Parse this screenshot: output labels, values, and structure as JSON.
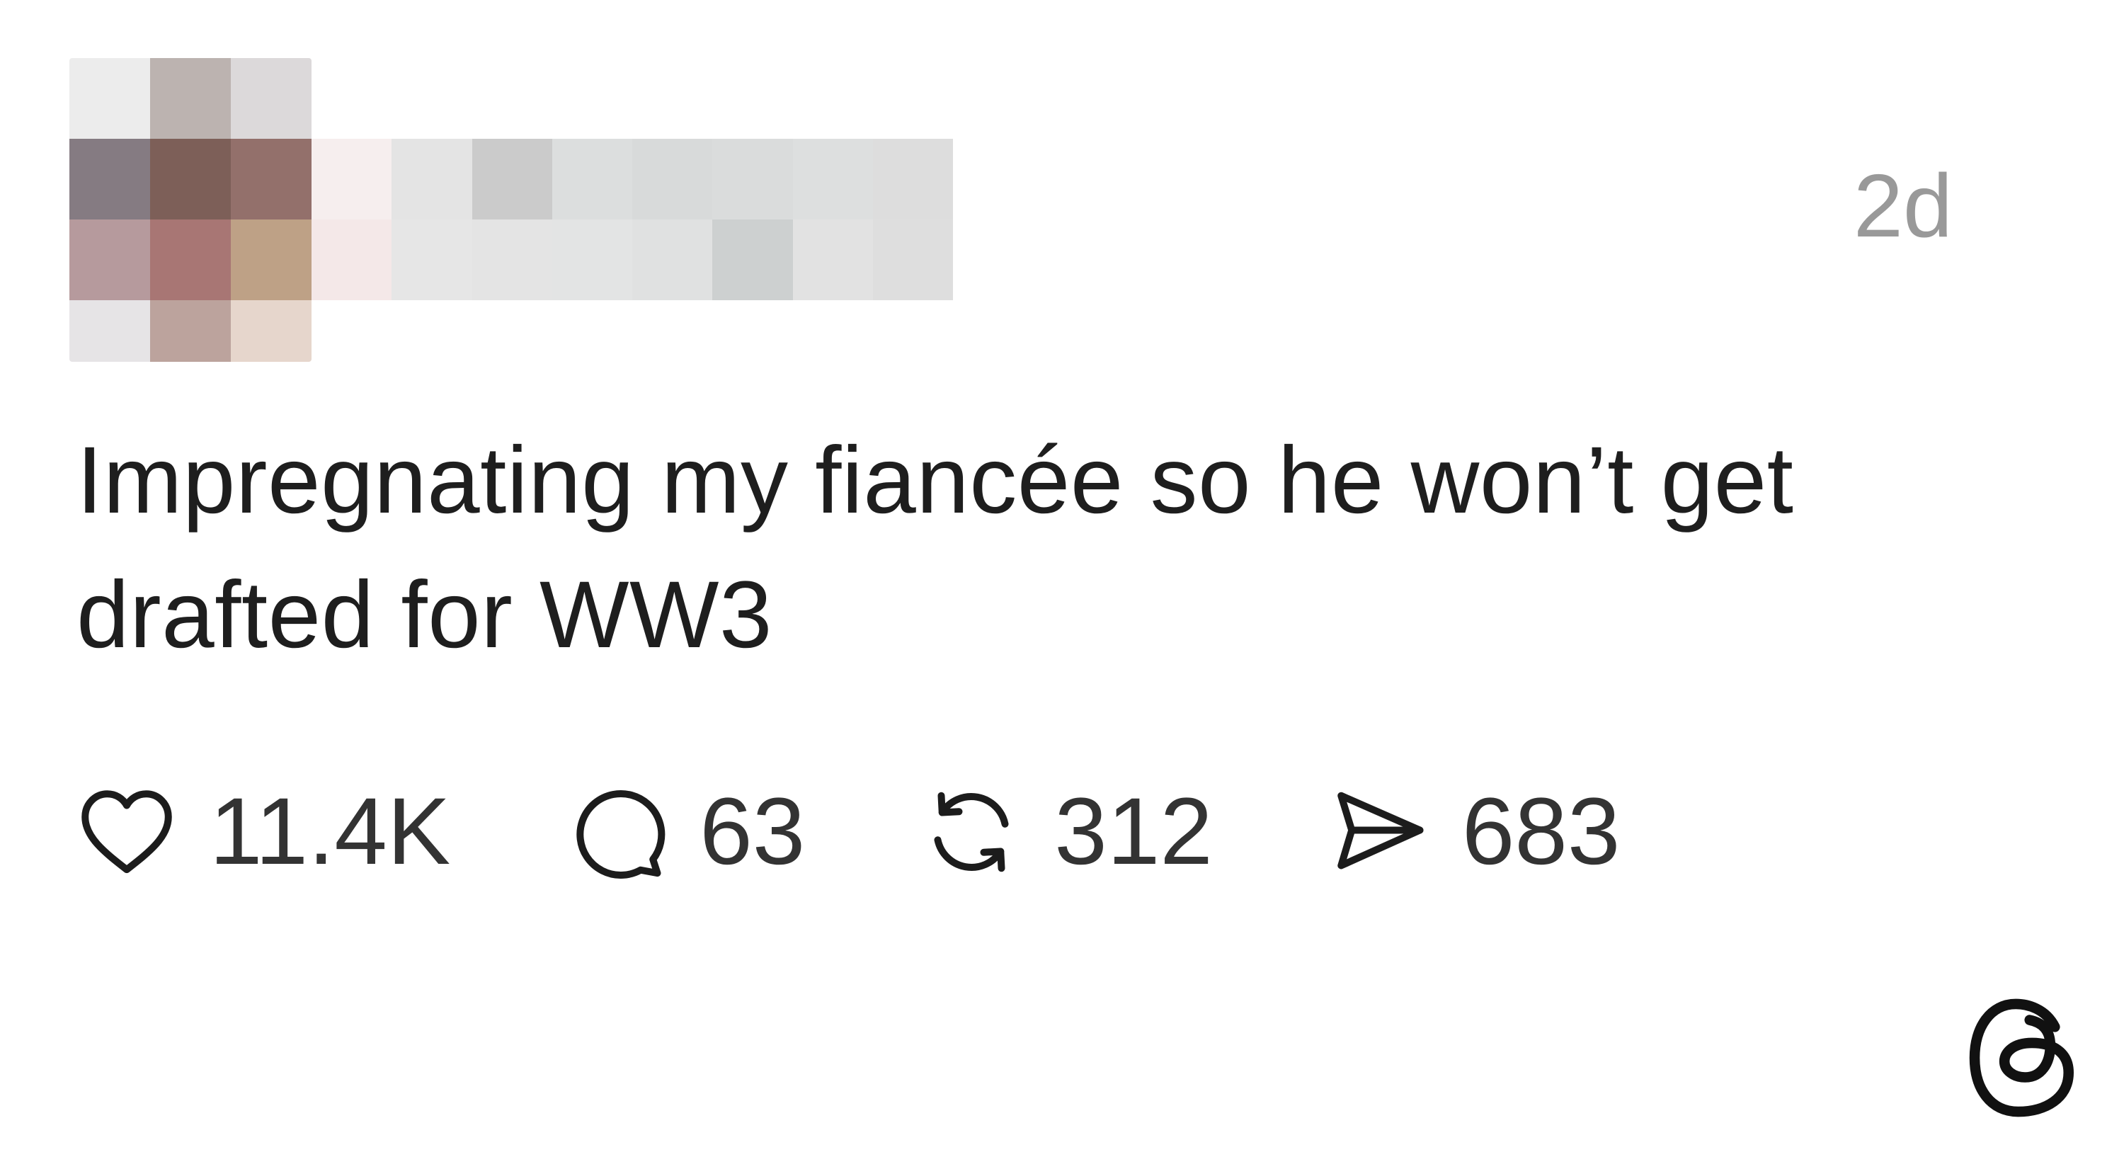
{
  "post": {
    "timestamp": "2d",
    "text": "Impregnating my fiancée so he won’t get drafted for WW3"
  },
  "actions": [
    {
      "name": "like",
      "icon": "heart-icon",
      "count": "11.4K"
    },
    {
      "name": "reply",
      "icon": "comment-bubble-icon",
      "count": "63"
    },
    {
      "name": "repost",
      "icon": "repost-icon",
      "count": "312"
    },
    {
      "name": "share",
      "icon": "send-icon",
      "count": "683"
    }
  ],
  "colors": {
    "text": "#1e1e1e",
    "secondary": "#999999",
    "icon": "#1c1c1c"
  }
}
